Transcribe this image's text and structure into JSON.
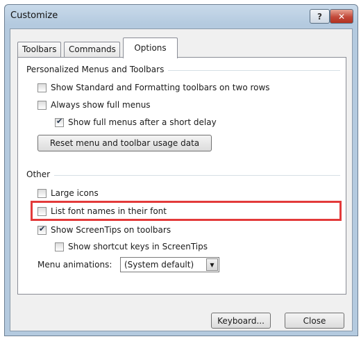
{
  "window": {
    "title": "Customize",
    "help_label": "?",
    "close_label": "✕"
  },
  "tabs": [
    {
      "label": "Toolbars"
    },
    {
      "label": "Commands"
    },
    {
      "label": "Options",
      "active": true
    }
  ],
  "personalized": {
    "heading": "Personalized Menus and Toolbars",
    "options": [
      {
        "label": "Show Standard and Formatting toolbars on two rows",
        "checked": false
      },
      {
        "label": "Always show full menus",
        "checked": false
      },
      {
        "label": "Show full menus after a short delay",
        "checked": true
      }
    ],
    "reset_button": "Reset menu and toolbar usage data"
  },
  "other": {
    "heading": "Other",
    "options": [
      {
        "label": "Large icons",
        "checked": false
      },
      {
        "label": "List font names in their font",
        "checked": false,
        "highlighted": true
      },
      {
        "label": "Show ScreenTips on toolbars",
        "checked": true
      },
      {
        "label": "Show shortcut keys in ScreenTips",
        "checked": false
      }
    ],
    "menu_animations_label": "Menu animations:",
    "menu_animations_value": "(System default)"
  },
  "footer": {
    "keyboard_button": "Keyboard...",
    "close_button": "Close"
  },
  "colors": {
    "highlight": "#e33a3a",
    "title_bar": "#b4cadf",
    "close_button": "#c2493a"
  }
}
